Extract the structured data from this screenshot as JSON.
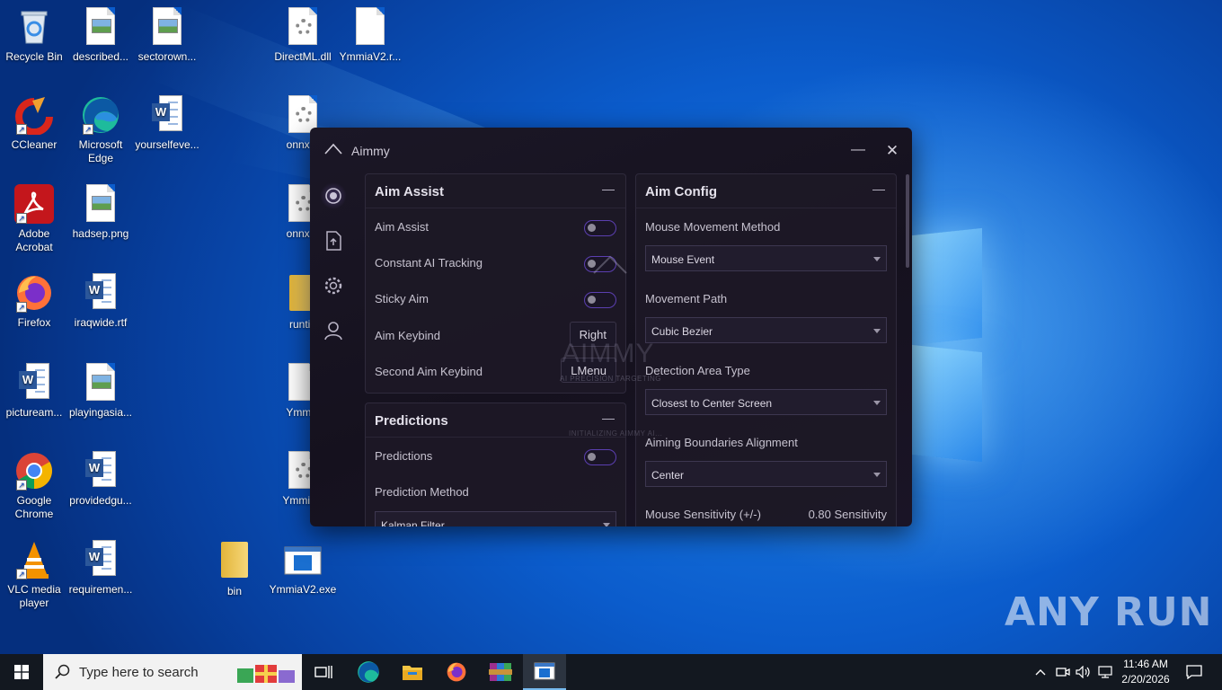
{
  "desktop": {
    "icons": [
      {
        "label": "Recycle Bin",
        "icon": "recycle-bin-icon"
      },
      {
        "label": "described...",
        "icon": "image-file-icon"
      },
      {
        "label": "sectorown...",
        "icon": "image-file-icon"
      },
      {
        "label": "DirectML.dll",
        "icon": "dll-file-icon"
      },
      {
        "label": "YmmiaV2.r...",
        "icon": "blank-file-icon"
      },
      {
        "label": "CCleaner",
        "icon": "ccleaner-icon"
      },
      {
        "label": "Microsoft Edge",
        "icon": "edge-icon"
      },
      {
        "label": "yourselfeve...",
        "icon": "word-doc-icon"
      },
      {
        "label": "onnxru",
        "icon": "dll-file-icon"
      },
      {
        "label": "Adobe Acrobat",
        "icon": "acrobat-icon"
      },
      {
        "label": "hadsep.png",
        "icon": "image-file-icon"
      },
      {
        "label": "onnxru",
        "icon": "dll-file-icon"
      },
      {
        "label": "Firefox",
        "icon": "firefox-icon"
      },
      {
        "label": "iraqwide.rtf",
        "icon": "word-doc-icon"
      },
      {
        "label": "runtin",
        "icon": "folder-icon"
      },
      {
        "label": "pictuream...",
        "icon": "word-doc-icon"
      },
      {
        "label": "playingasia...",
        "icon": "image-file-icon"
      },
      {
        "label": "Ymmia",
        "icon": "blank-file-icon"
      },
      {
        "label": "Google Chrome",
        "icon": "chrome-icon"
      },
      {
        "label": "providedgu...",
        "icon": "word-doc-icon"
      },
      {
        "label": "YmmiaV",
        "icon": "dll-file-icon"
      },
      {
        "label": "VLC media player",
        "icon": "vlc-icon"
      },
      {
        "label": "requiremen...",
        "icon": "word-doc-icon"
      },
      {
        "label": "bin",
        "icon": "folder-icon"
      },
      {
        "label": "YmmiaV2.exe",
        "icon": "exe-file-icon"
      }
    ]
  },
  "app": {
    "title": "Aimmy",
    "minimize": "—",
    "close": "✕",
    "nav": [
      "aim-menu",
      "models-menu",
      "settings-menu",
      "account-menu"
    ],
    "accent": "#5b3fb0",
    "aim_assist": {
      "title": "Aim Assist",
      "collapse": "—",
      "rows": {
        "aim_assist": "Aim Assist",
        "constant_tracking": "Constant AI Tracking",
        "sticky_aim": "Sticky Aim",
        "aim_keybind": "Aim Keybind",
        "aim_keybind_value": "Right",
        "second_keybind": "Second Aim Keybind",
        "second_keybind_value": "LMenu"
      }
    },
    "predictions": {
      "title": "Predictions",
      "collapse": "—",
      "toggle_label": "Predictions",
      "method_label": "Prediction Method",
      "method_value": "Kalman Filter"
    },
    "aim_config": {
      "title": "Aim Config",
      "collapse": "—",
      "movement_method_label": "Mouse Movement Method",
      "movement_method_value": "Mouse Event",
      "movement_path_label": "Movement Path",
      "movement_path_value": "Cubic Bezier",
      "detection_area_label": "Detection Area Type",
      "detection_area_value": "Closest to Center Screen",
      "boundaries_label": "Aiming Boundaries Alignment",
      "boundaries_value": "Center",
      "sensitivity_label": "Mouse Sensitivity (+/-)",
      "sensitivity_value": "0.80 Sensitivity"
    },
    "overlay": {
      "logo_text": "AIMMY",
      "tagline": "AI PRECISION TARGETING",
      "status": "INITIALIZING AIMMY AI..."
    }
  },
  "taskbar": {
    "search_placeholder": "Type here to search",
    "apps": [
      "task-view-icon",
      "edge-icon",
      "file-explorer-icon",
      "firefox-icon",
      "winrar-icon",
      "ymmia-app-icon"
    ],
    "time": "11:46 AM",
    "date": "2/20/2026"
  },
  "watermark": "ANY RUN"
}
